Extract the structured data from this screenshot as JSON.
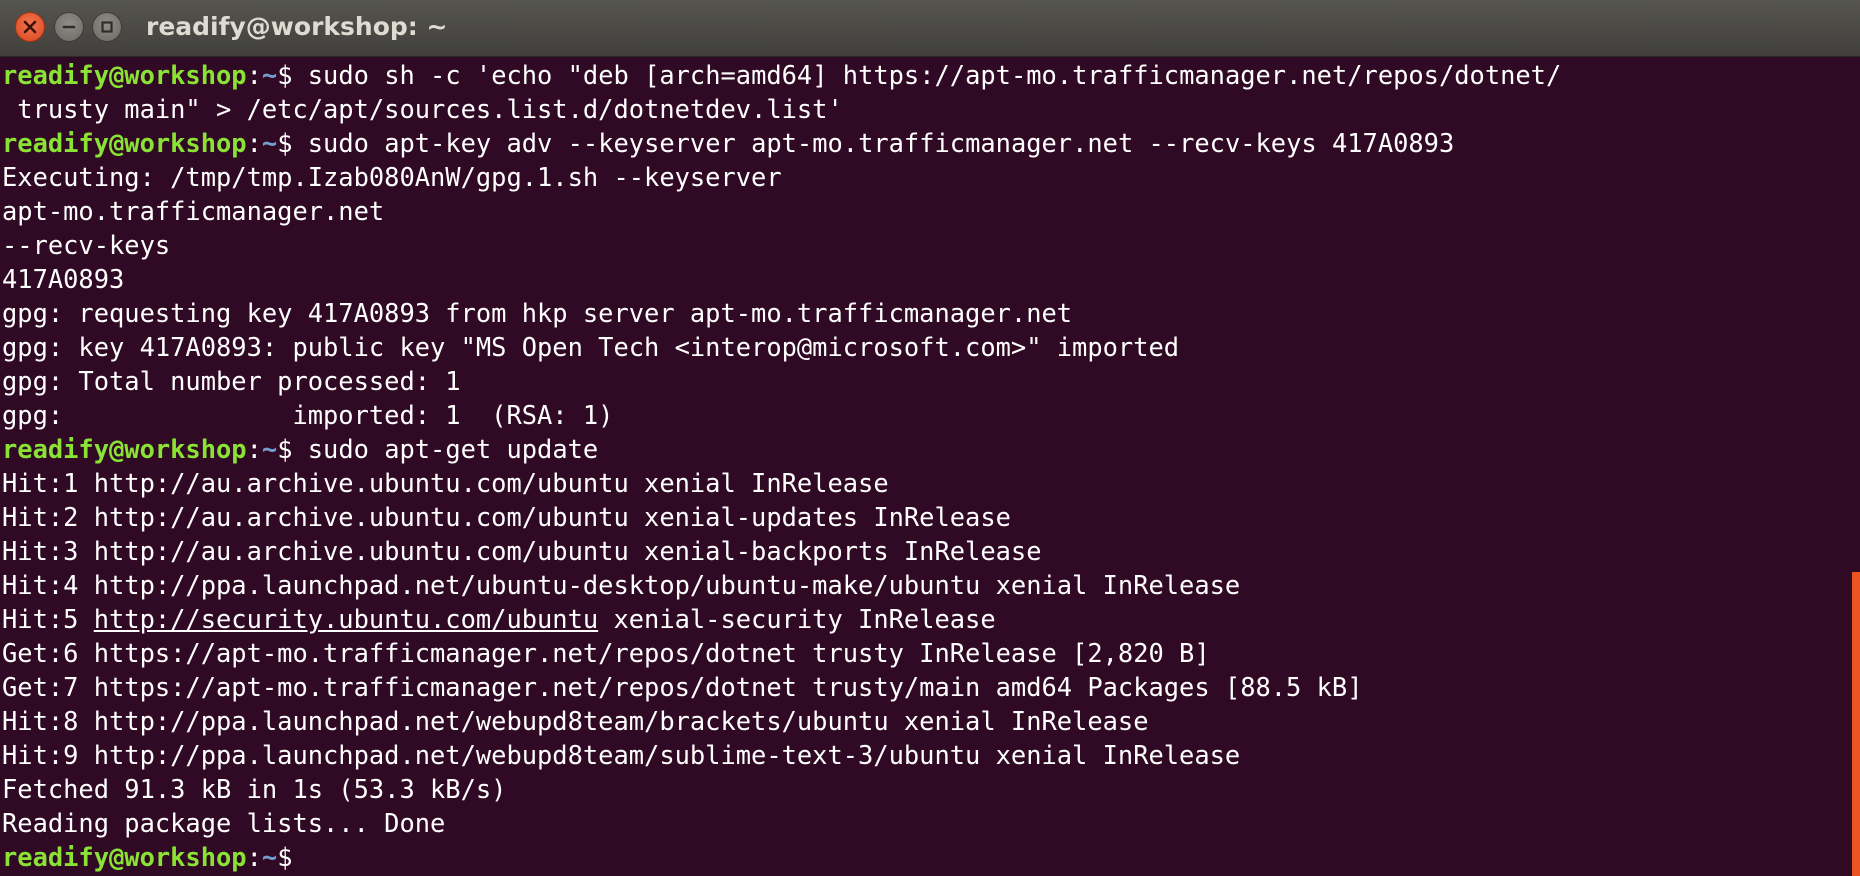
{
  "window": {
    "title": "readify@workshop: ~"
  },
  "icons": {
    "close": "close-icon",
    "minimize": "minimize-icon",
    "maximize": "maximize-icon"
  },
  "colors": {
    "background": "#300a24",
    "prompt_user": "#8ae234",
    "prompt_path": "#729fcf",
    "text": "#ffffff",
    "close_button": "#e95420",
    "scrollbar": "#e95420"
  },
  "prompt": {
    "user_host": "readify@workshop",
    "colon": ":",
    "path": "~",
    "symbol": "$ "
  },
  "terminal": {
    "cmd1_part1": "sudo sh -c 'echo \"deb [arch=amd64] https://apt-mo.trafficmanager.net/repos/dotnet/",
    "cmd1_part2": " trusty main\" > /etc/apt/sources.list.d/dotnetdev.list'",
    "cmd2": "sudo apt-key adv --keyserver apt-mo.trafficmanager.net --recv-keys 417A0893",
    "out_exec": "Executing: /tmp/tmp.Izab080AnW/gpg.1.sh --keyserver",
    "out_host": "apt-mo.trafficmanager.net",
    "out_recv": "--recv-keys",
    "out_keyid": "417A0893",
    "out_gpg1": "gpg: requesting key 417A0893 from hkp server apt-mo.trafficmanager.net",
    "out_gpg2": "gpg: key 417A0893: public key \"MS Open Tech <interop@microsoft.com>\" imported",
    "out_gpg3": "gpg: Total number processed: 1",
    "out_gpg4": "gpg:               imported: 1  (RSA: 1)",
    "cmd3": "sudo apt-get update",
    "hit1": "Hit:1 http://au.archive.ubuntu.com/ubuntu xenial InRelease",
    "hit2": "Hit:2 http://au.archive.ubuntu.com/ubuntu xenial-updates InRelease",
    "hit3": "Hit:3 http://au.archive.ubuntu.com/ubuntu xenial-backports InRelease",
    "hit4": "Hit:4 http://ppa.launchpad.net/ubuntu-desktop/ubuntu-make/ubuntu xenial InRelease",
    "hit5_prefix": "Hit:5 ",
    "hit5_link": "http://security.ubuntu.com/ubuntu",
    "hit5_suffix": " xenial-security InRelease",
    "get6": "Get:6 https://apt-mo.trafficmanager.net/repos/dotnet trusty InRelease [2,820 B]",
    "get7": "Get:7 https://apt-mo.trafficmanager.net/repos/dotnet trusty/main amd64 Packages [88.5 kB]",
    "hit8": "Hit:8 http://ppa.launchpad.net/webupd8team/brackets/ubuntu xenial InRelease",
    "hit9": "Hit:9 http://ppa.launchpad.net/webupd8team/sublime-text-3/ubuntu xenial InRelease",
    "fetched": "Fetched 91.3 kB in 1s (53.3 kB/s)",
    "reading": "Reading package lists... Done"
  }
}
